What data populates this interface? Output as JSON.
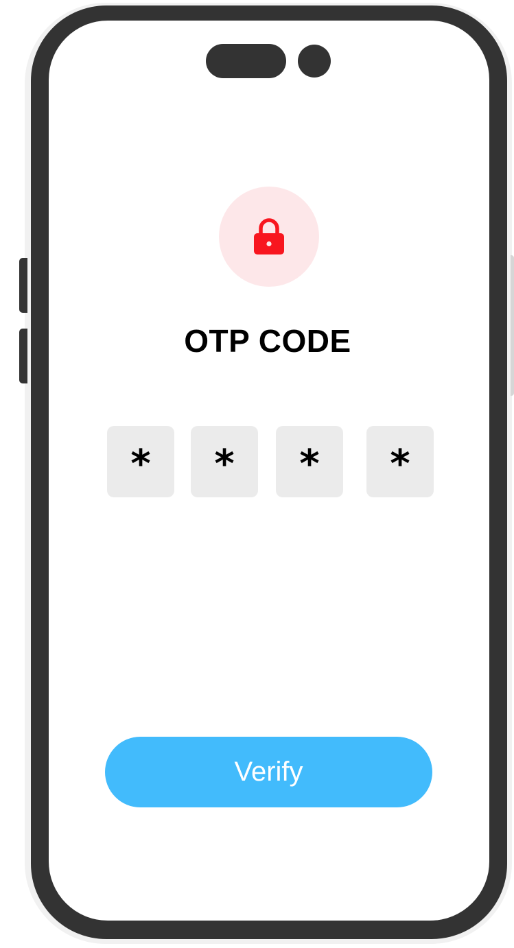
{
  "screen": {
    "title": "OTP CODE",
    "lock_icon": "lock-icon",
    "otp_digits": [
      "*",
      "*",
      "*",
      "*"
    ],
    "verify_label": "Verify"
  },
  "colors": {
    "accent": "#42bbfc",
    "lock": "#f8161f",
    "lock_bg": "#fde7e9",
    "otp_box": "#ebebeb",
    "frame": "#333333"
  }
}
